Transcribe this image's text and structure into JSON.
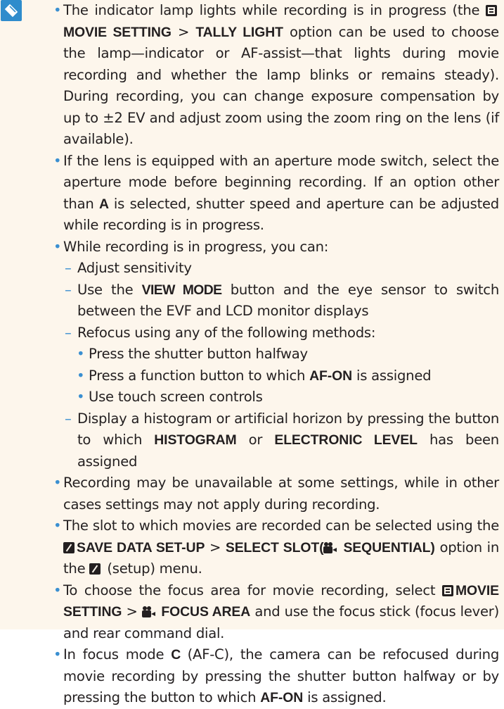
{
  "icon": "note-pencil-icon",
  "items": [
    {
      "kind": "bullet",
      "level": 1,
      "segments": [
        "The indicator lamp lights while recording is in progress (the ",
        {
          "glyph": "movie-setting-icon"
        },
        {
          "b": "MOVIE SETTING"
        },
        " > ",
        {
          "b": "TALLY LIGHT"
        },
        " option can be used to choose the lamp—indicator or AF-assist—that lights during movie recording and whether the lamp blinks or remains steady). During recording, you can change exposure compensation by up to ±2 EV and adjust zoom using the zoom ring on the lens (if available)."
      ]
    },
    {
      "kind": "bullet",
      "level": 1,
      "segments": [
        "If the lens is equipped with an aperture mode switch, select the ap­erture mode before beginning recording. If an option other than ",
        {
          "bc": "A"
        },
        " is selected, shutter speed and aperture can be adjusted while recording is in progress."
      ]
    },
    {
      "kind": "bullet",
      "level": 1,
      "segments": [
        "While recording is in progress, you can:"
      ]
    },
    {
      "kind": "dash",
      "level": 2,
      "segments": [
        "Adjust sensitivity"
      ]
    },
    {
      "kind": "dash",
      "level": 2,
      "segments": [
        "Use the ",
        {
          "bc": "VIEW MODE"
        },
        " button and the eye sensor to switch between the EVF and LCD monitor displays"
      ]
    },
    {
      "kind": "dash",
      "level": 2,
      "segments": [
        "Refocus using any of the following methods:"
      ]
    },
    {
      "kind": "bullet",
      "level": 3,
      "segments": [
        "Press the shutter button halfway"
      ]
    },
    {
      "kind": "bullet",
      "level": 3,
      "segments": [
        "Press a function button to which ",
        {
          "b": "AF-ON"
        },
        " is assigned"
      ]
    },
    {
      "kind": "bullet",
      "level": 3,
      "segments": [
        "Use touch screen controls"
      ]
    },
    {
      "kind": "dash",
      "level": 2,
      "segments": [
        "Display a histogram or artificial horizon by pressing the button to which ",
        {
          "b": "HISTOGRAM"
        },
        " or ",
        {
          "b": "ELECTRONIC LEVEL"
        },
        " has been assigned"
      ]
    },
    {
      "kind": "bullet",
      "level": 1,
      "segments": [
        "Recording may be unavailable at some settings, while in other cases settings may not apply during recording."
      ]
    },
    {
      "kind": "bullet",
      "level": 1,
      "segments": [
        "The slot to which movies are recorded can be selected using the ",
        {
          "glyph": "setup-icon"
        },
        {
          "b": "SAVE DATA SET-UP"
        },
        " > ",
        {
          "b": "SELECT SLOT("
        },
        {
          "glyph": "movie-camera-icon"
        },
        {
          "b": " SEQUENTIAL)"
        },
        " option in the ",
        {
          "glyph": "setup-icon"
        },
        " (setup) menu."
      ]
    },
    {
      "kind": "bullet",
      "level": 1,
      "segments": [
        "To choose the focus area for movie recording, select ",
        {
          "glyph": "movie-setting-icon"
        },
        {
          "b": "MOVIE SETTING"
        },
        " > ",
        {
          "glyph": "movie-camera-icon"
        },
        {
          "b": " FOCUS AREA"
        },
        " and use the focus stick (focus lever) and rear command dial."
      ]
    },
    {
      "kind": "bullet",
      "level": 1,
      "segments": [
        "In focus mode ",
        {
          "bc": "C"
        },
        " (AF-C), the camera can be refocused during movie recording by pressing the shutter button halfway or by pressing the button to which ",
        {
          "b": "AF-ON"
        },
        " is assigned."
      ]
    }
  ]
}
